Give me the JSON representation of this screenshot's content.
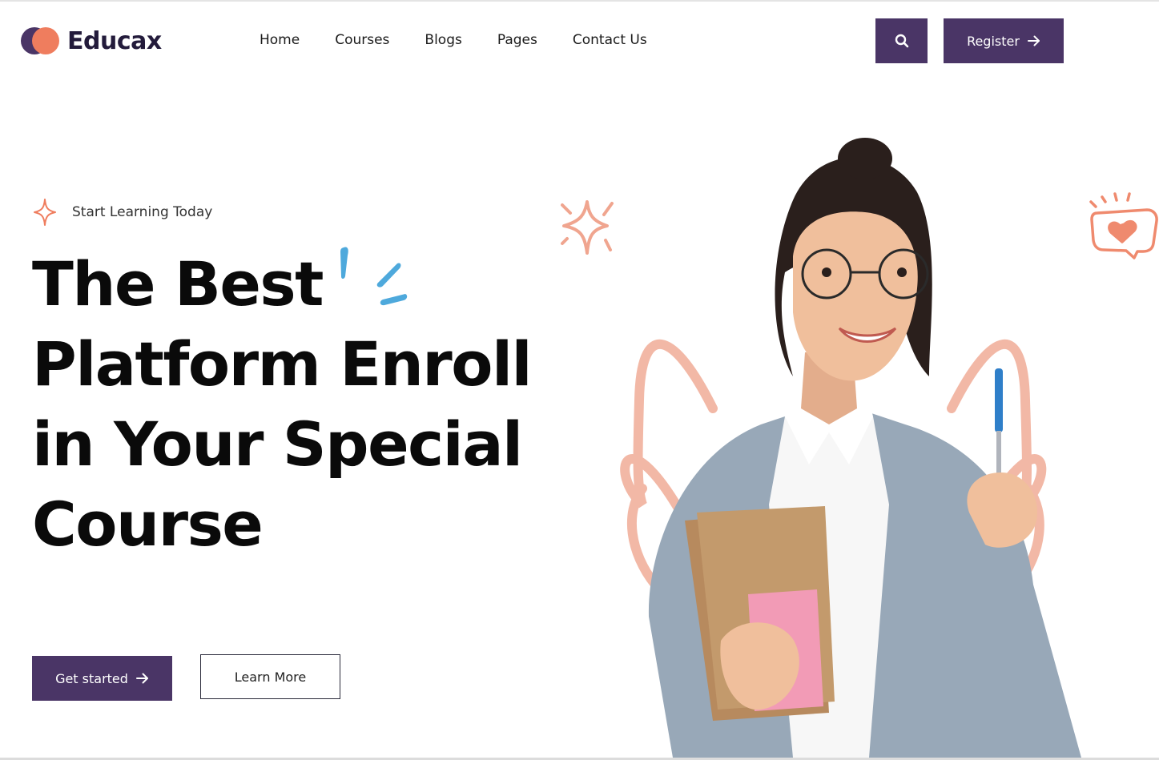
{
  "brand": {
    "name": "Educax"
  },
  "nav": {
    "items": [
      {
        "label": "Home"
      },
      {
        "label": "Courses"
      },
      {
        "label": "Blogs"
      },
      {
        "label": "Pages"
      },
      {
        "label": "Contact Us"
      }
    ]
  },
  "header": {
    "search_icon": "search-icon",
    "register_label": "Register"
  },
  "hero": {
    "tagline": "Start Learning Today",
    "title_lines": [
      "The Best",
      "Platform Enroll",
      "in Your Special",
      "Course"
    ],
    "primary_cta": "Get started",
    "secondary_cta": "Learn More"
  },
  "colors": {
    "brand_purple": "#4a3566",
    "accent_orange": "#ef7d5e",
    "accent_blue": "#4ea9dc",
    "accent_peach": "#f2b8a6"
  }
}
